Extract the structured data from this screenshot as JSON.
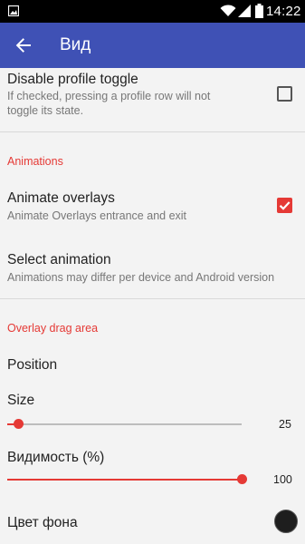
{
  "status_bar": {
    "time": "14:22"
  },
  "app_bar": {
    "title": "Вид"
  },
  "prefs": {
    "disable_profile_toggle": {
      "title": "Disable profile toggle",
      "summary_line1": "If checked, pressing a profile row will not",
      "summary_line2": "toggle its state.",
      "checked": false
    },
    "animations_header": "Animations",
    "animate_overlays": {
      "title": "Animate overlays",
      "summary": "Animate Overlays entrance and exit",
      "checked": true
    },
    "select_animation": {
      "title": "Select animation",
      "summary": "Animations may differ per device and Android version"
    },
    "overlay_header": "Overlay drag area",
    "position": {
      "title": "Position"
    },
    "size": {
      "title": "Size",
      "value": "25",
      "fraction": 0.05
    },
    "visibility": {
      "title": "Видимость (%)",
      "value": "100",
      "fraction": 1.0
    },
    "background_color": {
      "title": "Цвет фона",
      "color": "#1e1e1e"
    }
  },
  "colors": {
    "app_bar": "#3f51b5",
    "accent": "#e53935",
    "background": "#f3f3f3"
  }
}
